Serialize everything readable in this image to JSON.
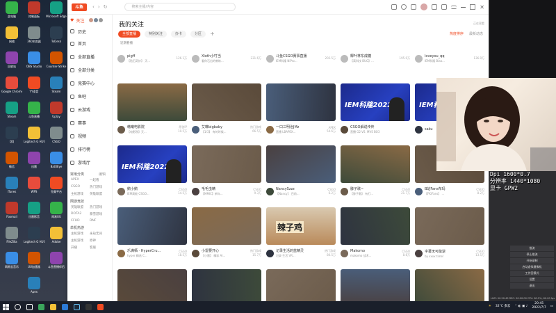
{
  "desktop": {
    "icons_col1": [
      "此电脑",
      "网络",
      "回收站",
      "Google Chrome",
      "Steam",
      "QQ",
      "微信",
      "iTunes",
      "Foxmail",
      "FileZilla",
      "网易云音乐"
    ],
    "icons_col2": [
      "控制面板",
      "360浏览器",
      "OBS Studio",
      "YY语音",
      "斗鱼直播",
      "Logitech G HUB",
      "迅雷",
      "WPS",
      "迅雷影音",
      "Logitech G HUB",
      "UU加速器",
      "Apex"
    ],
    "icons_col3": [
      "Microsoft Edge",
      "ToDesk",
      "Counter-Strike",
      "Steam",
      "Uplay",
      "CSGO",
      "BattlEye",
      "完美平台",
      "网易UU",
      "Adobe",
      "斗鱼直播伴侣"
    ]
  },
  "topbar": {
    "logo": "斗鱼",
    "search_placeholder": "搜索主播/内容"
  },
  "sidebar": {
    "follow": "关注",
    "items": [
      "历史",
      "首页",
      "全部直播",
      "全部分类",
      "竞赛中心",
      "鱼吧",
      "云游戏",
      "赛事",
      "视频",
      "排行榜",
      "游戏厅"
    ],
    "section1": "常用分类",
    "section1_more": "编辑",
    "cats1": [
      "APEX",
      "一起看",
      "CSGO",
      "热门游戏",
      "主机游戏",
      "英雄联盟"
    ],
    "section2": "网游竞技",
    "cats2": [
      "英雄联盟",
      "热门游戏",
      "DOTA2",
      "暴雪游戏",
      "CFHD",
      "DNF"
    ],
    "section3": "单机热游",
    "cats3": [
      "主机游戏",
      "永劫无间",
      "主机游戏",
      "原神",
      "开播",
      "客服"
    ]
  },
  "main": {
    "title": "我的关注",
    "info_right": "正在观看",
    "tabs": [
      "全部直播",
      "特别关注",
      "办卡",
      "分区"
    ],
    "sort_red": "热度排序",
    "sort_gray": "最新动态",
    "subtitle": "近期看播",
    "top_row": [
      {
        "name": "pigff",
        "sub": "【贴石奇妙】 天...",
        "count": "126.1万"
      },
      {
        "name": "Xieth小叮当",
        "sub": "看你石出的教练...",
        "count": "231.6万"
      },
      {
        "name": "斗鱼CSGO赛事直播",
        "sub": "IEM科隆 NiPro...",
        "count": "202.5万"
      },
      {
        "name": "椰叶林东成糖",
        "sub": "【高科技 BUG】...",
        "count": "195.0万"
      },
      {
        "name": "loveyou_qq",
        "sub": "IEM科隆 Biao...",
        "count": "136.0万"
      }
    ],
    "row1": [
      {
        "name": "韩曦电影院",
        "tag": "原创IP",
        "sub": "【电影院】天...",
        "count": "10.5万"
      },
      {
        "name": "艾琳bigbaby",
        "tag": "热门游戏",
        "sub": "【1/3】 有的时候...",
        "count": "66.5万"
      },
      {
        "name": "一口三明治JMz",
        "tag": "APEX",
        "sub": "直播 LBAPEX...",
        "count": "54.6万"
      },
      {
        "name": "CSGO解说传传",
        "tag": "",
        "sub": "直播 G2 VS. MVS BO3",
        "count": ""
      },
      {
        "name": "saku",
        "tag": "",
        "sub": "",
        "count": ""
      }
    ],
    "row2": [
      {
        "name": "鹅小鹅",
        "tag": "CSGO",
        "sub": "IEM高能 CSGO...",
        "count": "14.5万"
      },
      {
        "name": "毛毛虫精",
        "tag": "CSGO",
        "sub": "【MMIC】新年...",
        "count": "9.3万"
      },
      {
        "name": "NancySzzz",
        "tag": "CSGO",
        "sub": "【Nancy】 目前...",
        "count": "6.2万"
      },
      {
        "name": "脖子歌~",
        "tag": "CSGO",
        "sub": "【脖子歌】 有打...",
        "count": "21.7万"
      },
      {
        "name": "B站Fans布玛",
        "tag": "CSGO",
        "sub": "【FK/Fans】 ...",
        "count": "8.2万"
      }
    ],
    "row3": [
      {
        "name": "乐满栖 · HyperCru...",
        "tag": "CSGO",
        "sub": "hyper 精选 C...",
        "count": "18.5万"
      },
      {
        "name": "小雷要开心",
        "tag": "热门游戏",
        "sub": "【小雷】 精彩 AI...",
        "count": "15.7万"
      },
      {
        "name": "记录生活的蓝精灵",
        "tag": "热门游戏",
        "sub": "记录 生活 VR...",
        "count": "80.5万"
      },
      {
        "name": "Makomo",
        "tag": "CSGO",
        "sub": "makomo 战术...",
        "count": "8.8万"
      },
      {
        "name": "字幕无可能逆",
        "tag": "CSGO",
        "sub": "by xxxx time!",
        "count": "13.5万"
      }
    ],
    "thumb_iem": "IEM科隆2022",
    "thumb_char": "辣子鸡"
  },
  "obs": {
    "line1": "Dpi 1600*0.7",
    "line2": "分辨率 1440*1080",
    "line3": "显卡 GPW2",
    "buttons": [
      "推流",
      "停止推流",
      "开始录制",
      "启动虚拟摄像机",
      "工作室模式",
      "设置",
      "退出"
    ],
    "status": "LIVE: 00:20:45  REC: 00:00:00  CPU: 60.5%, 60.00 fps  kb/s: 9514"
  },
  "taskbar": {
    "weather": "32°C 多云",
    "time": "20:45",
    "date": "2022/7/7"
  },
  "colors": {
    "accent": "#f04b23",
    "iem": "#1c2a8c"
  }
}
